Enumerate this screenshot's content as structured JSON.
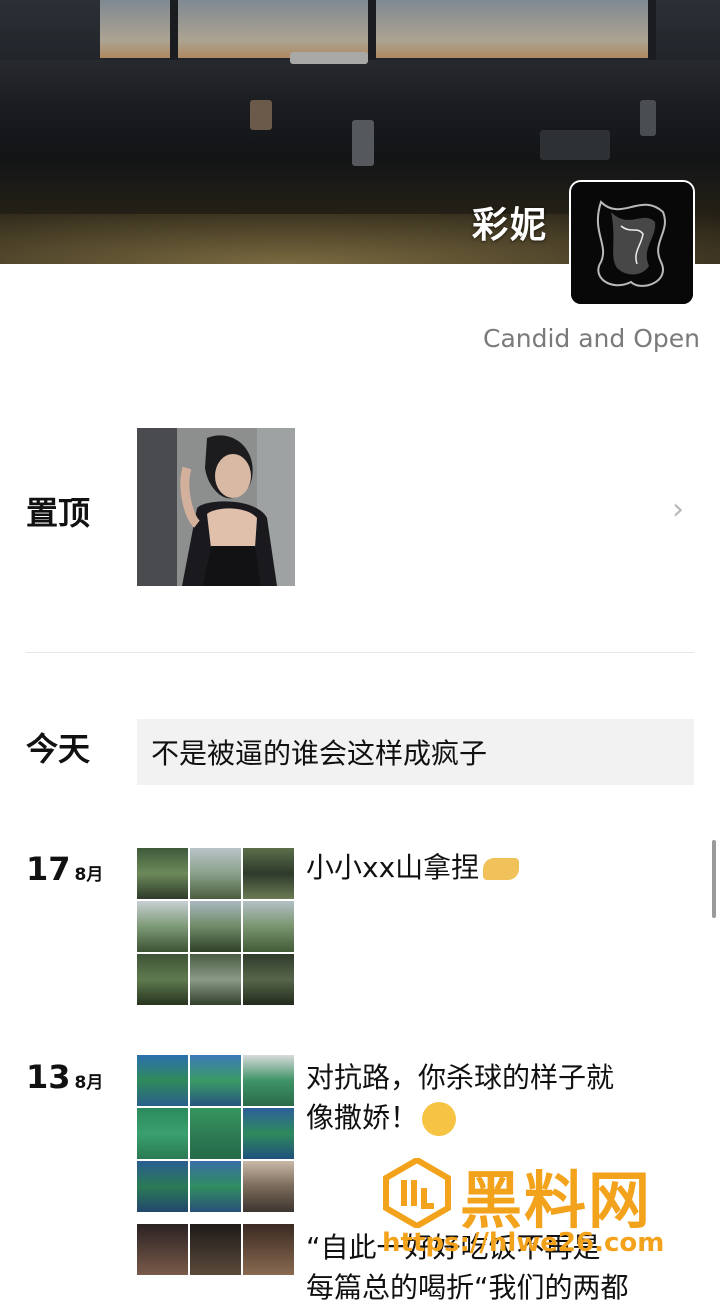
{
  "profile": {
    "name": "彩妮",
    "signature": "Candid and Open"
  },
  "pinned": {
    "label": "置顶"
  },
  "today": {
    "label": "今天",
    "text": "不是被逼的谁会这样成疯子"
  },
  "posts": [
    {
      "day": "17",
      "month": "8月",
      "text": "小小xx山拿捏",
      "emoji": "pinching-hand-emoji"
    },
    {
      "day": "13",
      "month": "8月",
      "text_line1": "对抗路，你杀球的样子就",
      "text_line2": "像撒娇！",
      "emoji": "face-emoji",
      "text2_line1": "“自此一好好吃饭不再是",
      "text2_line2": "每篇总的喝折“我们的两都"
    }
  ],
  "watermark": {
    "title": "黑料网",
    "url": "https://hlwe26.com"
  },
  "colors": {
    "watermark": "#f3a21c",
    "card_bg": "#f2f2f2",
    "signature": "#7a7a7a"
  }
}
